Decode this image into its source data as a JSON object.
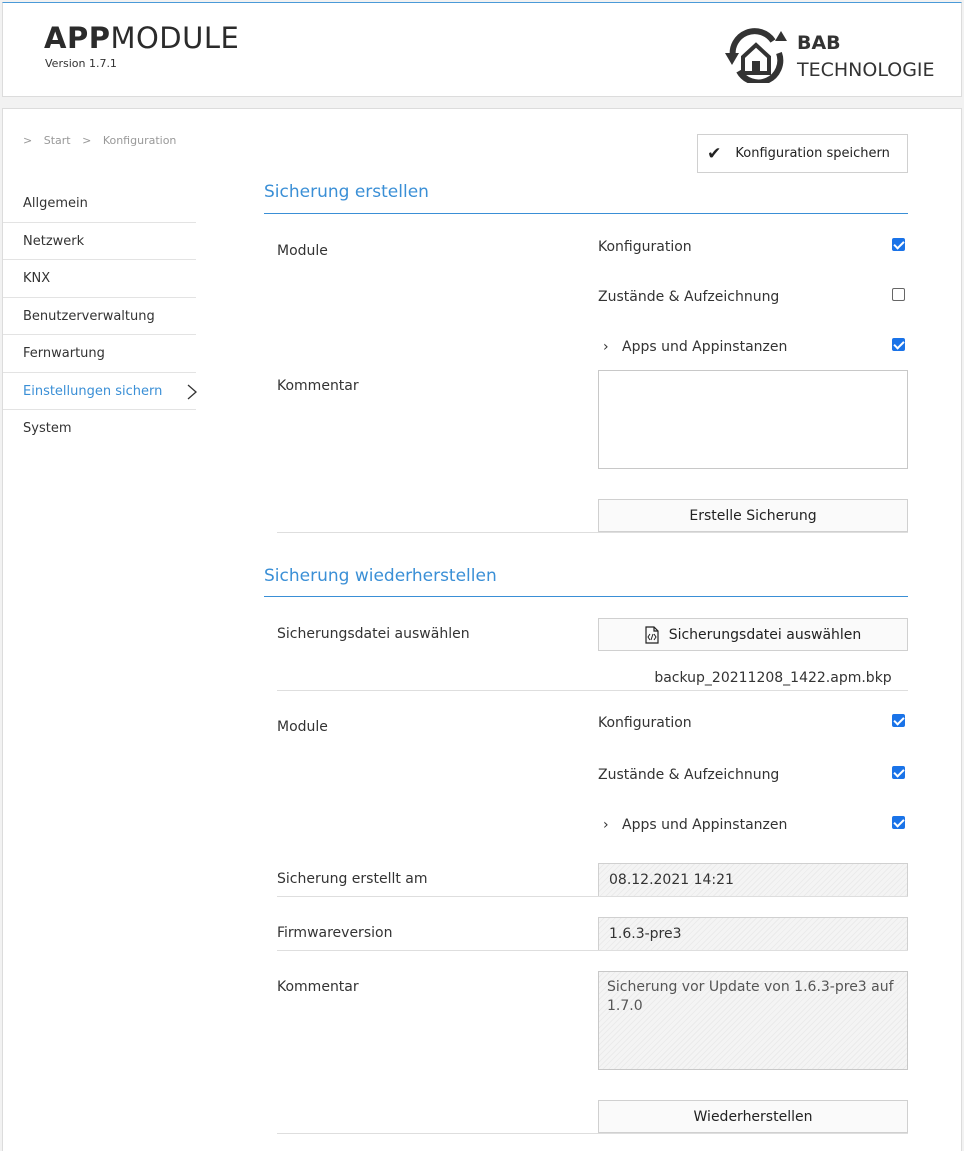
{
  "header": {
    "app_name_bold": "APP",
    "app_name_regular": "MODULE",
    "version": "Version 1.7.1",
    "logo_line1": "BAB",
    "logo_line2": "TECHNOLOGIE"
  },
  "breadcrumb": {
    "sep": ">",
    "items": [
      "Start",
      "Konfiguration"
    ]
  },
  "nav": {
    "items": [
      {
        "label": "Allgemein"
      },
      {
        "label": "Netzwerk"
      },
      {
        "label": "KNX"
      },
      {
        "label": "Benutzerverwaltung"
      },
      {
        "label": "Fernwartung"
      },
      {
        "label": "Einstellungen sichern",
        "active": true
      },
      {
        "label": "System"
      }
    ]
  },
  "toolbar": {
    "save_label": "Konfiguration speichern"
  },
  "backup": {
    "title": "Sicherung erstellen",
    "modules_label": "Module",
    "options": [
      {
        "label": "Konfiguration",
        "checked": true
      },
      {
        "label": "Zustände & Aufzeichnung",
        "checked": false
      },
      {
        "label": "Apps und Appinstanzen",
        "checked": true
      }
    ],
    "comment_label": "Kommentar",
    "comment_value": "",
    "create_button": "Erstelle Sicherung"
  },
  "restore": {
    "title": "Sicherung wiederherstellen",
    "file_label": "Sicherungsdatei auswählen",
    "file_button": "Sicherungsdatei auswählen",
    "file_name": "backup_20211208_1422.apm.bkp",
    "modules_label": "Module",
    "options": [
      {
        "label": "Konfiguration",
        "checked": true
      },
      {
        "label": "Zustände & Aufzeichnung",
        "checked": true
      },
      {
        "label": "Apps und Appinstanzen",
        "checked": true
      }
    ],
    "created_label": "Sicherung erstellt am",
    "created_value": "08.12.2021 14:21",
    "firmware_label": "Firmwareversion",
    "firmware_value": "1.6.3-pre3",
    "comment_label": "Kommentar",
    "comment_value": "Sicherung vor Update von 1.6.3-pre3 auf 1.7.0",
    "restore_button": "Wiederherstellen"
  },
  "colors": {
    "accent": "#3a8fd6",
    "checkbox": "#1a73e8"
  }
}
